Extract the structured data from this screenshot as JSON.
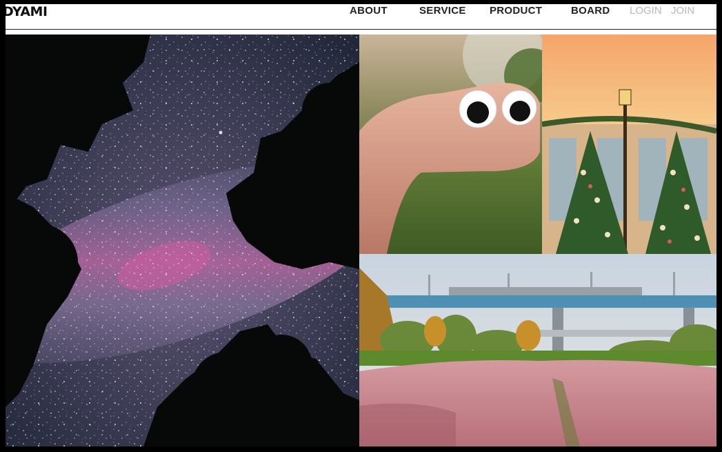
{
  "header": {
    "logo": "DYAMI",
    "nav": [
      "ABOUT",
      "SERVICE",
      "PRODUCT",
      "BOARD"
    ],
    "auth": {
      "login": "LOGIN",
      "join": "JOIN"
    }
  },
  "gallery": {
    "images": [
      {
        "name": "milky-way-night-sky-photo",
        "alt": "Milky way between silhouetted trees"
      },
      {
        "name": "googly-eyes-hand-photo",
        "alt": "Hand with googly eyes"
      },
      {
        "name": "christmas-trees-photo",
        "alt": "Christmas trees at sunset building"
      },
      {
        "name": "pink-muhly-field-photo",
        "alt": "Pink grass field under a bridge"
      }
    ]
  },
  "colors": {
    "frame": "#000000",
    "nav_text": "#222222",
    "auth_text": "#b8b8b8"
  }
}
